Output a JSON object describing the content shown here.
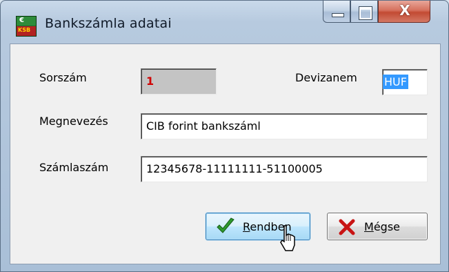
{
  "window": {
    "title": "Bankszámla adatai",
    "app_icon": "green-red-app-icon",
    "app_icon_mark": "€",
    "app_icon_text": "KSB",
    "close_glyph": "X"
  },
  "form": {
    "sorszam_label": "Sorszám",
    "sorszam_value": "1",
    "devizanem_label": "Devizanem",
    "devizanem_value": "HUF",
    "megnevezes_label": "Megnevezés",
    "megnevezes_value": "CIB forint bankszáml",
    "szamlaszam_label": "Számlaszám",
    "szamlaszam_value": "12345678-11111111-51100005"
  },
  "buttons": {
    "ok_prefix": "R",
    "ok_rest": "endben",
    "cancel_prefix": "M",
    "cancel_rest": "égse"
  },
  "colors": {
    "ok_check": "#2e9a2e",
    "cancel_x": "#c81414",
    "selection": "#3399ff",
    "sorszam_value": "#d00000"
  }
}
